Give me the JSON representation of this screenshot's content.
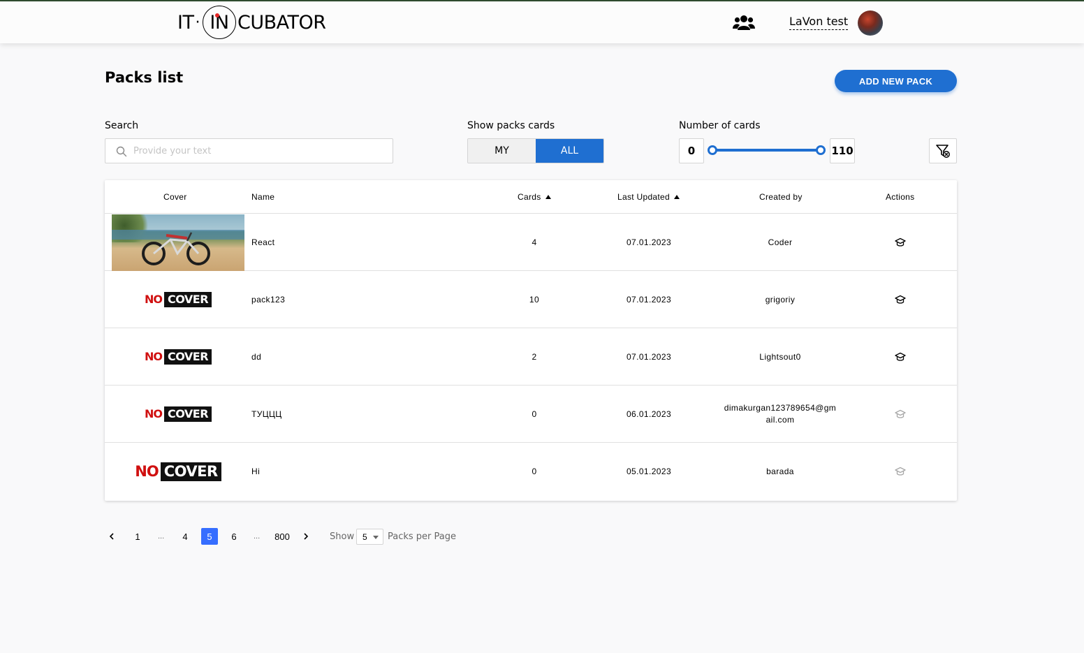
{
  "header": {
    "logo": {
      "it": "IT",
      "sep": "·",
      "in": "IN",
      "rest": "CUBATOR"
    },
    "user_name": "LaVon test"
  },
  "main": {
    "title": "Packs list",
    "add_button": "ADD NEW PACK"
  },
  "filters": {
    "search_label": "Search",
    "search_placeholder": "Provide your text",
    "search_value": "",
    "show_label": "Show packs cards",
    "show_options": [
      "MY",
      "ALL"
    ],
    "show_selected": "ALL",
    "number_label": "Number of cards",
    "min": "0",
    "max": "110"
  },
  "table": {
    "headers": [
      "Cover",
      "Name",
      "Cards",
      "Last Updated",
      "Created by",
      "Actions"
    ],
    "rows": [
      {
        "name": "React",
        "cards": "4",
        "updated": "07.01.2023",
        "created_by": "Coder",
        "cover": "image"
      },
      {
        "name": "pack123",
        "cards": "10",
        "updated": "07.01.2023",
        "created_by": "grigoriy",
        "cover": "no-cover"
      },
      {
        "name": "dd",
        "cards": "2",
        "updated": "07.01.2023",
        "created_by": "Lightsout0",
        "cover": "no-cover"
      },
      {
        "name": "ТУЦЦЦ",
        "cards": "0",
        "updated": "06.01.2023",
        "created_by": "dimakurgan123789654@gmail.com",
        "cover": "no-cover"
      },
      {
        "name": "Hi",
        "cards": "0",
        "updated": "05.01.2023",
        "created_by": "barada",
        "cover": "no-cover-large"
      }
    ],
    "no_cover": {
      "no": "NO",
      "cover": "COVER"
    }
  },
  "pagination": {
    "pages": [
      "1",
      "...",
      "4",
      "5",
      "6",
      "...",
      "800"
    ],
    "current": "5",
    "show_label": "Show",
    "per_page": "5",
    "per_page_suffix": "Packs per Page"
  },
  "colors": {
    "accent": "#1f6fd1",
    "active_page": "#366eff",
    "no_cover_red": "#d01010"
  },
  "icons": [
    "users-icon",
    "search-icon",
    "filter-off-icon",
    "learn-icon",
    "chevron-left-icon",
    "chevron-right-icon"
  ]
}
